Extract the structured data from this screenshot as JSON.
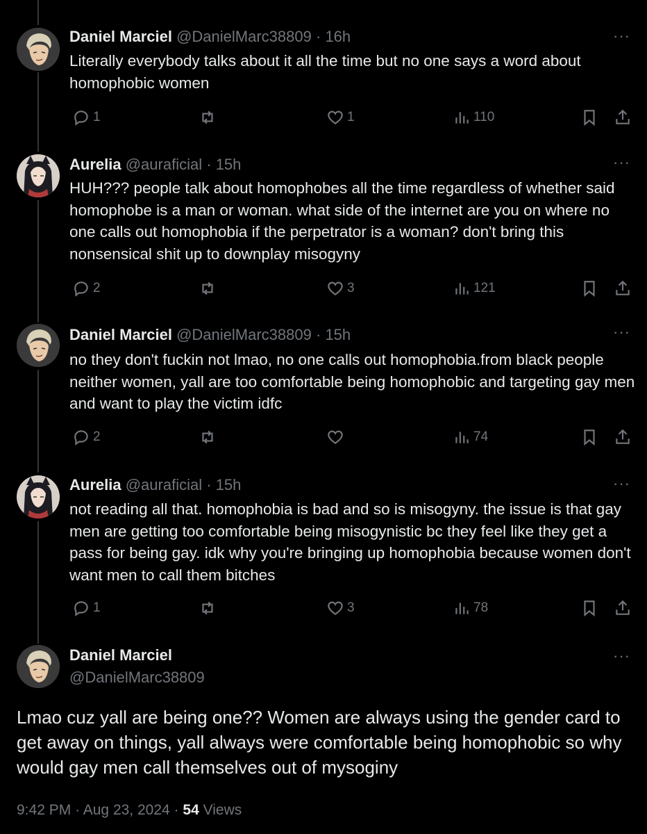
{
  "replies": [
    {
      "name": "Daniel Marciel",
      "handle": "@DanielMarc38809",
      "time": "16h",
      "text": "Literally everybody talks about it all the time but no one says a word about homophobic women",
      "replies_count": "1",
      "retweets_count": "",
      "likes_count": "1",
      "views_count": "110"
    },
    {
      "name": "Aurelia",
      "handle": "@auraficial",
      "time": "15h",
      "text": "HUH??? people talk about homophobes all the time regardless of whether said homophobe is a man or woman. what side of the internet are you on where no one calls out homophobia if the perpetrator is a woman? don't bring this nonsensical shit up to downplay misogyny",
      "replies_count": "2",
      "retweets_count": "",
      "likes_count": "3",
      "views_count": "121"
    },
    {
      "name": "Daniel Marciel",
      "handle": "@DanielMarc38809",
      "time": "15h",
      "text": "no they don't fuckin not lmao, no one calls out homophobia.from black people neither women, yall are too comfortable being homophobic and targeting gay men and want to play the victim idfc",
      "replies_count": "2",
      "retweets_count": "",
      "likes_count": "",
      "views_count": "74"
    },
    {
      "name": "Aurelia",
      "handle": "@auraficial",
      "time": "15h",
      "text": "not reading all that. homophobia is bad and so is misogyny. the issue is that gay men are getting too comfortable being misogynistic bc they feel like they get a pass for being gay. idk why you're bringing up homophobia because women don't want men to call them bitches",
      "replies_count": "1",
      "retweets_count": "",
      "likes_count": "3",
      "views_count": "78"
    }
  ],
  "main": {
    "name": "Daniel Marciel",
    "handle": "@DanielMarc38809",
    "text": "Lmao cuz yall are being one?? Women are always using the gender card to get away on things, yall always were comfortable being homophobic so why would gay men call themselves out of mysoginy",
    "time": "9:42 PM",
    "date": "Aug 23, 2024",
    "views_count": "54",
    "views_label": "Views"
  },
  "separator": "·",
  "more_label": "···",
  "icons": [
    "reply-icon",
    "retweet-icon",
    "like-icon",
    "views-icon",
    "bookmark-icon",
    "share-icon",
    "more-icon"
  ],
  "colors": {
    "background": "#000000",
    "text": "#e7e9ea",
    "muted": "#71767b",
    "thread_line": "#333639"
  }
}
